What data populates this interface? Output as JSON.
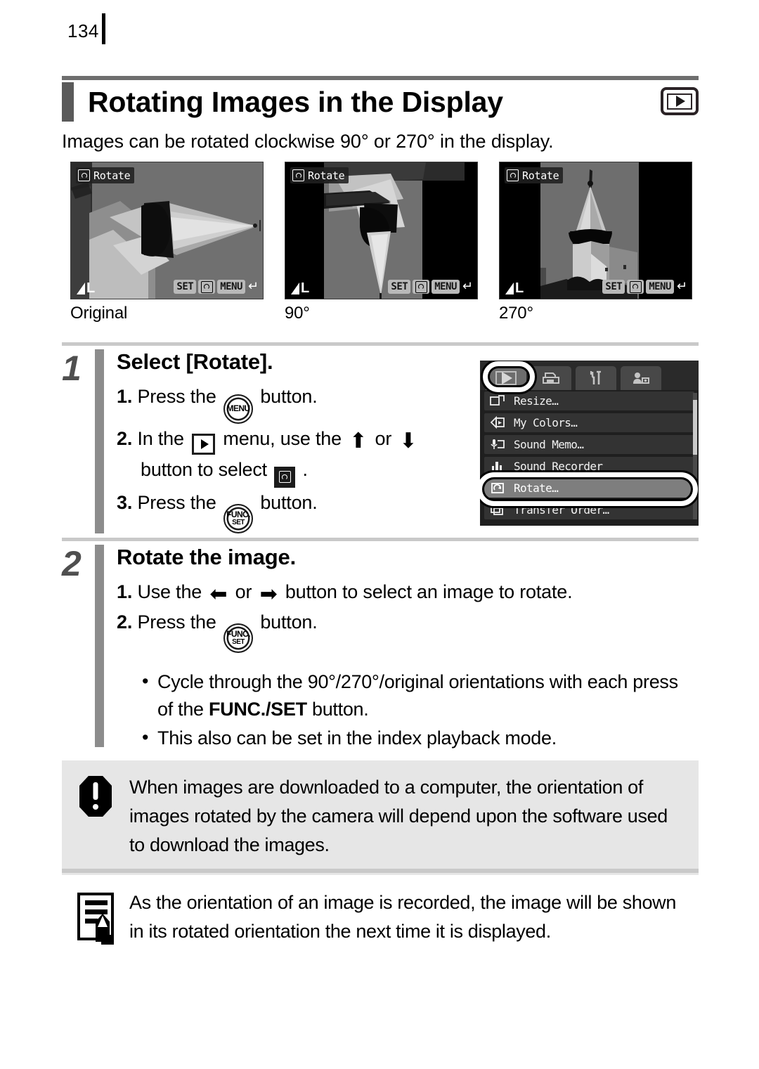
{
  "page": {
    "number": "134"
  },
  "header": {
    "title": "Rotating Images in the Display",
    "badge_icon": "playback-icon",
    "intro": "Images can be rotated clockwise 90° or 270° in the display."
  },
  "examples": [
    {
      "caption": "Original",
      "osd_label": "Rotate",
      "quality": "L",
      "controls": {
        "set": "SET",
        "menu": "MENU",
        "return_icon": "return-arrow-icon",
        "rotate_icon": "rotate-icon"
      }
    },
    {
      "caption": "90°",
      "osd_label": "Rotate",
      "quality": "L",
      "controls": {
        "set": "SET",
        "menu": "MENU",
        "return_icon": "return-arrow-icon",
        "rotate_icon": "rotate-icon"
      }
    },
    {
      "caption": "270°",
      "osd_label": "Rotate",
      "quality": "L",
      "controls": {
        "set": "SET",
        "menu": "MENU",
        "return_icon": "return-arrow-icon",
        "rotate_icon": "rotate-icon"
      }
    }
  ],
  "steps": [
    {
      "number": "1",
      "heading": "Select [Rotate].",
      "lines": {
        "l1_num": "1.",
        "l1_a": "Press the",
        "l1_btn": "MENU",
        "l1_b": "button.",
        "l2_num": "2.",
        "l2_a": "In the",
        "l2_b": "menu, use the",
        "l2_or": "or",
        "l3_a": "button to select",
        "l3_b": ".",
        "l4_num": "3.",
        "l4_a": "Press the",
        "l4_btn_top": "FUNC.",
        "l4_btn_bottom": "SET",
        "l4_b": "button."
      }
    },
    {
      "number": "2",
      "heading": "Rotate the image.",
      "lines": {
        "l1_num": "1.",
        "l1_a": "Use the",
        "l1_or": "or",
        "l1_b": "button to select an image to rotate.",
        "l2_num": "2.",
        "l2_a": "Press the",
        "l2_btn_top": "FUNC.",
        "l2_btn_bottom": "SET",
        "l2_b": "button."
      },
      "bullets": {
        "b1_a": "Cycle through the 90°/270°/original orientations with each press",
        "b1_b": "of the",
        "b1_strong": "FUNC./SET",
        "b1_c": "button.",
        "b2": "This also can be set in the index playback mode."
      }
    }
  ],
  "camera_menu": {
    "tabs": [
      {
        "name": "playback-tab",
        "icon": "playback-icon",
        "active": true
      },
      {
        "name": "print-tab",
        "icon": "printer-icon",
        "active": false
      },
      {
        "name": "settings-tab",
        "icon": "tools-icon",
        "active": false
      },
      {
        "name": "my-camera-tab",
        "icon": "my-camera-icon",
        "active": false
      }
    ],
    "items": [
      {
        "label": "Resize…",
        "icon": "resize-icon",
        "selected": false
      },
      {
        "label": "My Colors…",
        "icon": "my-colors-icon",
        "selected": false
      },
      {
        "label": "Sound Memo…",
        "icon": "sound-memo-icon",
        "selected": false
      },
      {
        "label": "Sound Recorder",
        "icon": "sound-recorder-icon",
        "selected": false
      },
      {
        "label": "Rotate…",
        "icon": "rotate-icon",
        "selected": true
      },
      {
        "label": "Transfer Order…",
        "icon": "transfer-order-icon",
        "selected": false
      }
    ]
  },
  "caution": {
    "icon": "exclamation-octagon-icon",
    "text": "When images are downloaded to a computer, the orientation of images rotated by the camera will depend upon the software used to download the images."
  },
  "note": {
    "icon": "memo-pencil-icon",
    "text": "As the orientation of an image is recorded, the image will be shown in its rotated orientation the next time it is displayed."
  },
  "colors": {
    "accent_gray": "#8c8c8c",
    "rule_gray": "#c9c9c9",
    "caution_bg": "#e6e6e6",
    "title_tab": "#5a5a5a"
  }
}
